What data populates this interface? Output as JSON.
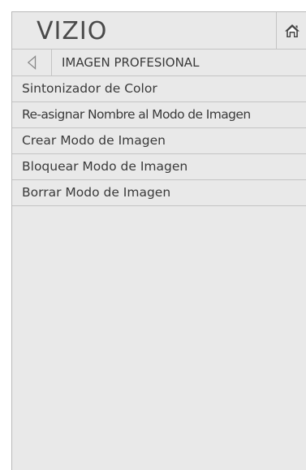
{
  "header": {
    "logo_text": "VIZIO",
    "home_icon": "home-icon"
  },
  "nav": {
    "back_icon": "back-arrow-icon",
    "title": "IMAGEN PROFESIONAL"
  },
  "menu": {
    "items": [
      {
        "label": "Sintonizador de Color"
      },
      {
        "label": "Re-asignar Nombre al Modo de Imagen"
      },
      {
        "label": "Crear Modo de Imagen"
      },
      {
        "label": "Bloquear Modo de Imagen"
      },
      {
        "label": "Borrar Modo de Imagen"
      }
    ]
  },
  "colors": {
    "panel_background": "#e9e9e9",
    "divider": "#c4c4c4",
    "text": "#3a3a3a"
  }
}
